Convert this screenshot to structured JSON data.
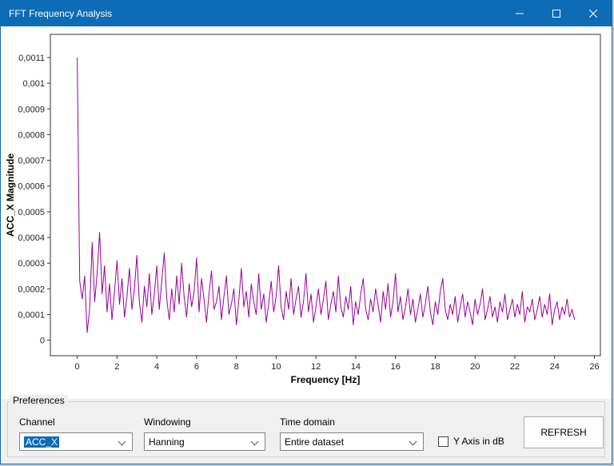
{
  "window": {
    "title": "FFT Frequency Analysis"
  },
  "preferences": {
    "group_label": "Preferences",
    "channel": {
      "label": "Channel",
      "value": "ACC_X"
    },
    "windowing": {
      "label": "Windowing",
      "value": "Hanning"
    },
    "time_domain": {
      "label": "Time domain",
      "value": "Entire dataset"
    },
    "y_axis_db": {
      "label": "Y Axis in dB",
      "checked": false
    },
    "refresh_label": "REFRESH"
  },
  "chart_data": {
    "type": "line",
    "title": "",
    "xlabel": "Frequency [Hz]",
    "ylabel": "ACC_X Magnitude",
    "line_color": "#990099",
    "grid": false,
    "legend": "none",
    "xlim": [
      -1.35,
      26.3
    ],
    "ylim": [
      -6e-05,
      0.00119
    ],
    "x_ticks": [
      0,
      2,
      4,
      6,
      8,
      10,
      12,
      14,
      16,
      18,
      20,
      22,
      24,
      26
    ],
    "x_tick_labels": [
      "0",
      "2",
      "4",
      "6",
      "8",
      "10",
      "12",
      "14",
      "16",
      "18",
      "20",
      "22",
      "24",
      "26"
    ],
    "y_ticks": [
      0,
      0.0001,
      0.0002,
      0.0003,
      0.0004,
      0.0005,
      0.0006,
      0.0007,
      0.0008,
      0.0009,
      0.001,
      0.0011
    ],
    "y_tick_labels": [
      "0",
      "0,0001",
      "0,0002",
      "0,0003",
      "0,0004",
      "0,0005",
      "0,0006",
      "0,0007",
      "0,0008",
      "0,0009",
      "0,001",
      "0,0011"
    ],
    "x_start": 0,
    "x_step": 0.125,
    "y_multiplier": 0.0001,
    "magnitudes": [
      11,
      2.3,
      1.6,
      2.5,
      0.3,
      1.2,
      3.8,
      1.5,
      2.6,
      4.2,
      1.8,
      2.9,
      1.1,
      2.2,
      0.8,
      1.9,
      3.1,
      1.4,
      2.4,
      0.9,
      1.7,
      2.8,
      1.2,
      2.0,
      3.3,
      1.5,
      0.7,
      2.1,
      1.3,
      2.6,
      1.0,
      1.8,
      2.9,
      1.2,
      2.3,
      3.4,
      1.6,
      0.8,
      2.0,
      1.1,
      2.5,
      1.4,
      3.0,
      1.7,
      0.9,
      2.2,
      1.3,
      1.9,
      3.2,
      1.1,
      2.4,
      1.6,
      0.7,
      1.8,
      2.7,
      1.2,
      1.5,
      2.1,
      0.8,
      1.7,
      2.5,
      1.0,
      1.4,
      2.0,
      0.6,
      1.6,
      2.8,
      1.3,
      1.9,
      0.9,
      2.2,
      1.5,
      1.0,
      2.6,
      1.2,
      1.8,
      0.7,
      1.4,
      2.3,
      1.1,
      1.7,
      2.9,
      1.3,
      0.8,
      1.9,
      1.2,
      2.4,
      1.0,
      1.6,
      2.1,
      0.9,
      1.5,
      2.6,
      1.1,
      1.8,
      0.7,
      1.3,
      2.0,
      1.0,
      1.6,
      2.3,
      0.8,
      1.4,
      1.9,
      1.1,
      2.5,
      1.3,
      0.9,
      1.7,
      1.2,
      2.1,
      0.6,
      1.5,
      1.0,
      1.8,
      2.4,
      1.2,
      0.8,
      1.6,
      1.1,
      2.0,
      1.4,
      0.7,
      1.9,
      1.2,
      2.2,
      0.9,
      1.5,
      2.6,
      1.1,
      1.7,
      0.8,
      1.3,
      2.0,
      1.0,
      1.6,
      0.7,
      1.2,
      1.8,
      0.9,
      1.4,
      2.1,
      1.1,
      0.6,
      1.5,
      1.0,
      1.9,
      2.4,
      1.2,
      0.8,
      1.4,
      1.0,
      1.7,
      0.7,
      1.3,
      1.8,
      0.9,
      1.5,
      1.1,
      0.6,
      1.6,
      1.0,
      1.4,
      2.0,
      0.8,
      1.2,
      1.7,
      0.9,
      1.3,
      0.7,
      1.5,
      1.1,
      1.8,
      0.8,
      1.2,
      1.6,
      0.9,
      1.4,
      1.0,
      1.9,
      0.7,
      1.3,
      1.1,
      1.6,
      0.8,
      1.2,
      1.7,
      0.9,
      1.4,
      1.0,
      1.8,
      0.6,
      1.2,
      1.5,
      0.8,
      1.3,
      1.0,
      1.6,
      0.9,
      1.2,
      0.8
    ]
  }
}
